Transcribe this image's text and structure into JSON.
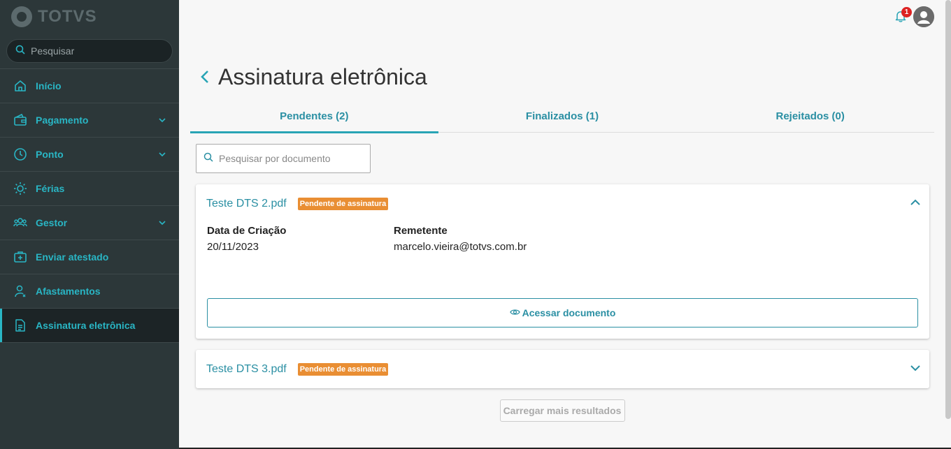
{
  "brand": {
    "name": "TOTVS"
  },
  "sidebar": {
    "search_placeholder": "Pesquisar",
    "items": [
      {
        "label": "Início",
        "icon": "home-icon",
        "has_chevron": false
      },
      {
        "label": "Pagamento",
        "icon": "wallet-icon",
        "has_chevron": true
      },
      {
        "label": "Ponto",
        "icon": "clock-icon",
        "has_chevron": true
      },
      {
        "label": "Férias",
        "icon": "sun-icon",
        "has_chevron": false
      },
      {
        "label": "Gestor",
        "icon": "team-icon",
        "has_chevron": true
      },
      {
        "label": "Enviar atestado",
        "icon": "medical-kit-icon",
        "has_chevron": false
      },
      {
        "label": "Afastamentos",
        "icon": "user-away-icon",
        "has_chevron": false
      },
      {
        "label": "Assinatura eletrônica",
        "icon": "document-icon",
        "has_chevron": false,
        "active": true
      }
    ]
  },
  "header": {
    "notification_count": "1"
  },
  "page": {
    "title": "Assinatura eletrônica",
    "tabs": [
      {
        "label": "Pendentes (2)",
        "active": true
      },
      {
        "label": "Finalizados (1)",
        "active": false
      },
      {
        "label": "Rejeitados (0)",
        "active": false
      }
    ],
    "search_placeholder": "Pesquisar por documento",
    "documents": [
      {
        "name": "Teste DTS 2.pdf",
        "status": "Pendente de assinatura",
        "expanded": true,
        "created_label": "Data de Criação",
        "created_value": "20/11/2023",
        "sender_label": "Remetente",
        "sender_value": "marcelo.vieira@totvs.com.br",
        "action_label": "Acessar documento"
      },
      {
        "name": "Teste DTS 3.pdf",
        "status": "Pendente de assinatura",
        "expanded": false
      }
    ],
    "load_more_label": "Carregar mais resultados"
  },
  "colors": {
    "accent": "#29a4b5",
    "sidebar_bg": "#2c3739",
    "badge": "#e98e33"
  }
}
